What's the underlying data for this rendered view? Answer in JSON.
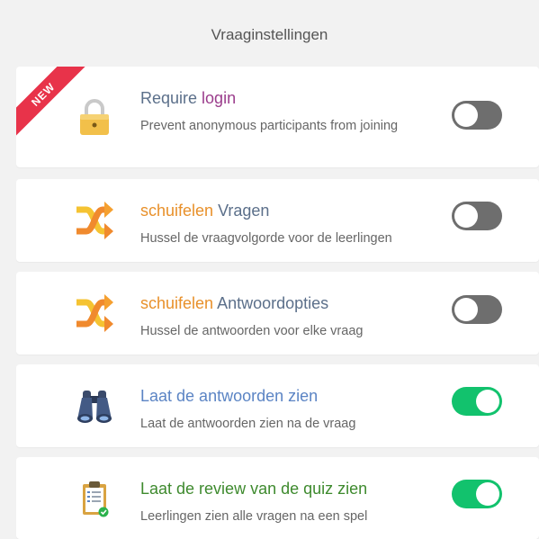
{
  "header": {
    "title": "Vraaginstellingen"
  },
  "settings": [
    {
      "badge": "NEW",
      "title_parts": [
        {
          "text": "Require ",
          "color": "#5b6f8a"
        },
        {
          "text": "login",
          "color": "#9b3d8c"
        }
      ],
      "description": "Prevent anonymous participants from joining",
      "icon": "padlock-icon",
      "enabled": false
    },
    {
      "title_parts": [
        {
          "text": "schuifelen ",
          "color": "#e8902a"
        },
        {
          "text": "Vragen",
          "color": "#5b6f8a"
        }
      ],
      "description": "Hussel de vraagvolgorde voor de leerlingen",
      "icon": "shuffle-icon",
      "enabled": false
    },
    {
      "title_parts": [
        {
          "text": "schuifelen ",
          "color": "#e8902a"
        },
        {
          "text": "Antwoordopties",
          "color": "#5b6f8a"
        }
      ],
      "description": "Hussel de antwoorden voor elke vraag",
      "icon": "shuffle-icon",
      "enabled": false
    },
    {
      "title_parts": [
        {
          "text": "Laat de antwoorden zien",
          "color": "#5b84c4"
        }
      ],
      "description": "Laat de antwoorden zien na de vraag",
      "icon": "binoculars-icon",
      "enabled": true
    },
    {
      "title_parts": [
        {
          "text": "Laat de review van de quiz zien",
          "color": "#3e8a2e"
        }
      ],
      "description": "Leerlingen zien alle vragen na een spel",
      "icon": "clipboard-icon",
      "enabled": true
    }
  ],
  "colors": {
    "toggle_on": "#12c26d",
    "toggle_off": "#6e6e6e",
    "badge": "#e8334a"
  }
}
